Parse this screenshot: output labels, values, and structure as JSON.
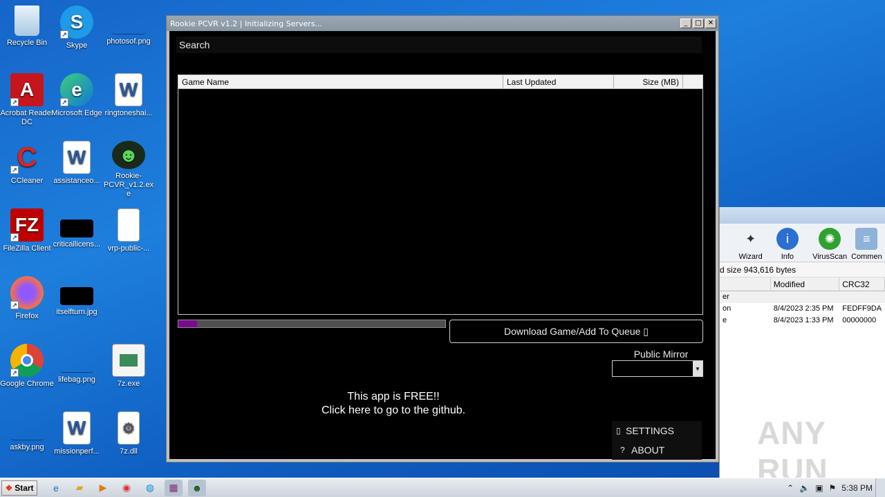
{
  "desktop": {
    "icons": [
      {
        "label": "Recycle Bin",
        "icon": "recycle-bin-icon"
      },
      {
        "label": "Skype",
        "icon": "skype-icon"
      },
      {
        "label": "photosof.png",
        "icon": "image-file-icon"
      },
      {
        "label": "Acrobat Reader DC",
        "icon": "acrobat-icon"
      },
      {
        "label": "Microsoft Edge",
        "icon": "edge-icon"
      },
      {
        "label": "ringtoneshai...",
        "icon": "word-doc-icon"
      },
      {
        "label": "CCleaner",
        "icon": "ccleaner-icon"
      },
      {
        "label": "assistanceo...",
        "icon": "word-doc-icon"
      },
      {
        "label": "Rookie-PCVR_v1.2.exe",
        "icon": "rookie-app-icon"
      },
      {
        "label": "FileZilla Client",
        "icon": "filezilla-icon"
      },
      {
        "label": "criticallicens...",
        "icon": "image-file-icon"
      },
      {
        "label": "vrp-public-...",
        "icon": "blank-file-icon"
      },
      {
        "label": "Firefox",
        "icon": "firefox-icon"
      },
      {
        "label": "itselfturn.jpg",
        "icon": "image-file-icon"
      },
      {
        "label": "Google Chrome",
        "icon": "chrome-icon"
      },
      {
        "label": "lifebag.png",
        "icon": "image-file-icon"
      },
      {
        "label": "7z.exe",
        "icon": "exe-file-icon"
      },
      {
        "label": "askby.png",
        "icon": "image-file-icon"
      },
      {
        "label": "missionperf...",
        "icon": "word-doc-icon"
      },
      {
        "label": "7z.dll",
        "icon": "dll-file-icon"
      }
    ]
  },
  "app": {
    "title": "Rookie PCVR v1.2 | Initializing Servers...",
    "search_label": "Search",
    "columns": [
      "Game Name",
      "Last Updated",
      "Size (MB)"
    ],
    "progress": 0.07,
    "download_button": "Download Game/Add To Queue ▯",
    "mirror_label": "Public Mirror",
    "mirror_value": "",
    "free_line1": "This app is FREE!!",
    "free_line2": "Click here to go to the github.",
    "menu": [
      {
        "icon": "▯",
        "label": "SETTINGS"
      },
      {
        "icon": "?",
        "label": "ABOUT"
      }
    ],
    "colors": {
      "progress": "#7a0a8f",
      "background": "#000000"
    }
  },
  "bgwindow": {
    "tools": [
      {
        "label": "Wizard",
        "icon": "wizard-icon"
      },
      {
        "label": "Info",
        "icon": "info-icon"
      },
      {
        "label": "VirusScan",
        "icon": "virusscan-icon"
      },
      {
        "label": "Commen",
        "icon": "comment-icon"
      }
    ],
    "size_text": "d size 943,616 bytes",
    "columns": [
      "Modified",
      "CRC32"
    ],
    "rows": [
      {
        "name": "er",
        "modified": "",
        "crc": ""
      },
      {
        "name": "on",
        "modified": "8/4/2023 2:35 PM",
        "crc": "FEDFF9DA"
      },
      {
        "name": "e",
        "modified": "8/4/2023 1:33 PM",
        "crc": "00000000"
      }
    ]
  },
  "watermark": "ANY RUN",
  "taskbar": {
    "start_label": "Start",
    "clock": "5:38 PM"
  }
}
